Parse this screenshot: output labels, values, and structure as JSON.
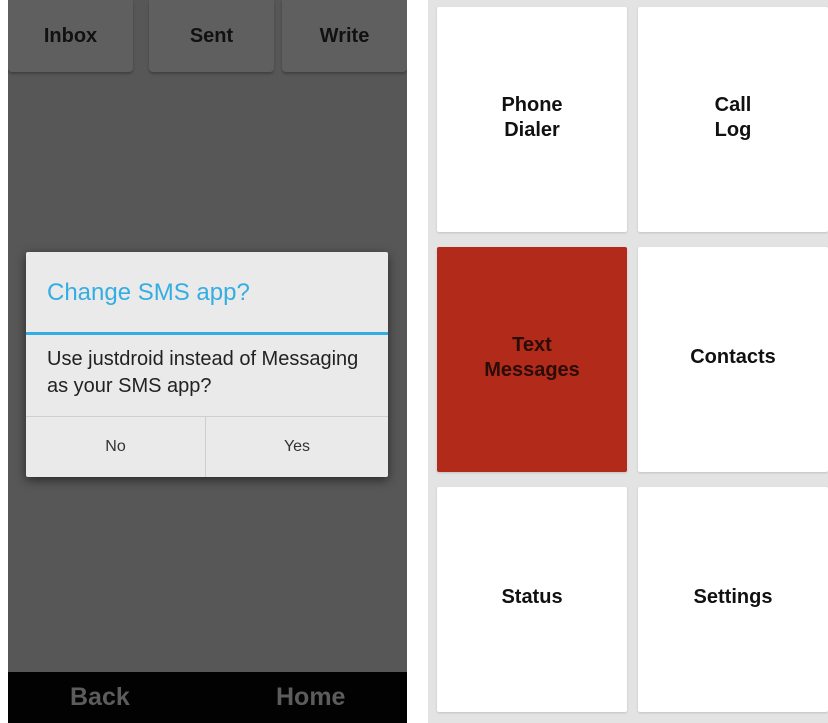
{
  "left_screen": {
    "tabs": {
      "inbox": "Inbox",
      "sent": "Sent",
      "write": "Write"
    },
    "bottom_bar": {
      "back": "Back",
      "home": "Home"
    },
    "dialog": {
      "title": "Change SMS app?",
      "message": "Use justdroid instead of Messaging as your SMS app?",
      "no_label": "No",
      "yes_label": "Yes"
    }
  },
  "right_screen": {
    "tiles": [
      {
        "label": "Phone\nDialer"
      },
      {
        "label": "Call\nLog"
      },
      {
        "label": "Text\nMessages",
        "active": true
      },
      {
        "label": "Contacts"
      },
      {
        "label": "Status"
      },
      {
        "label": "Settings"
      }
    ]
  },
  "colors": {
    "accent_blue": "#34aee2",
    "active_tile": "#b22a1a",
    "left_background": "#575757",
    "right_background": "#e3e3e3"
  }
}
